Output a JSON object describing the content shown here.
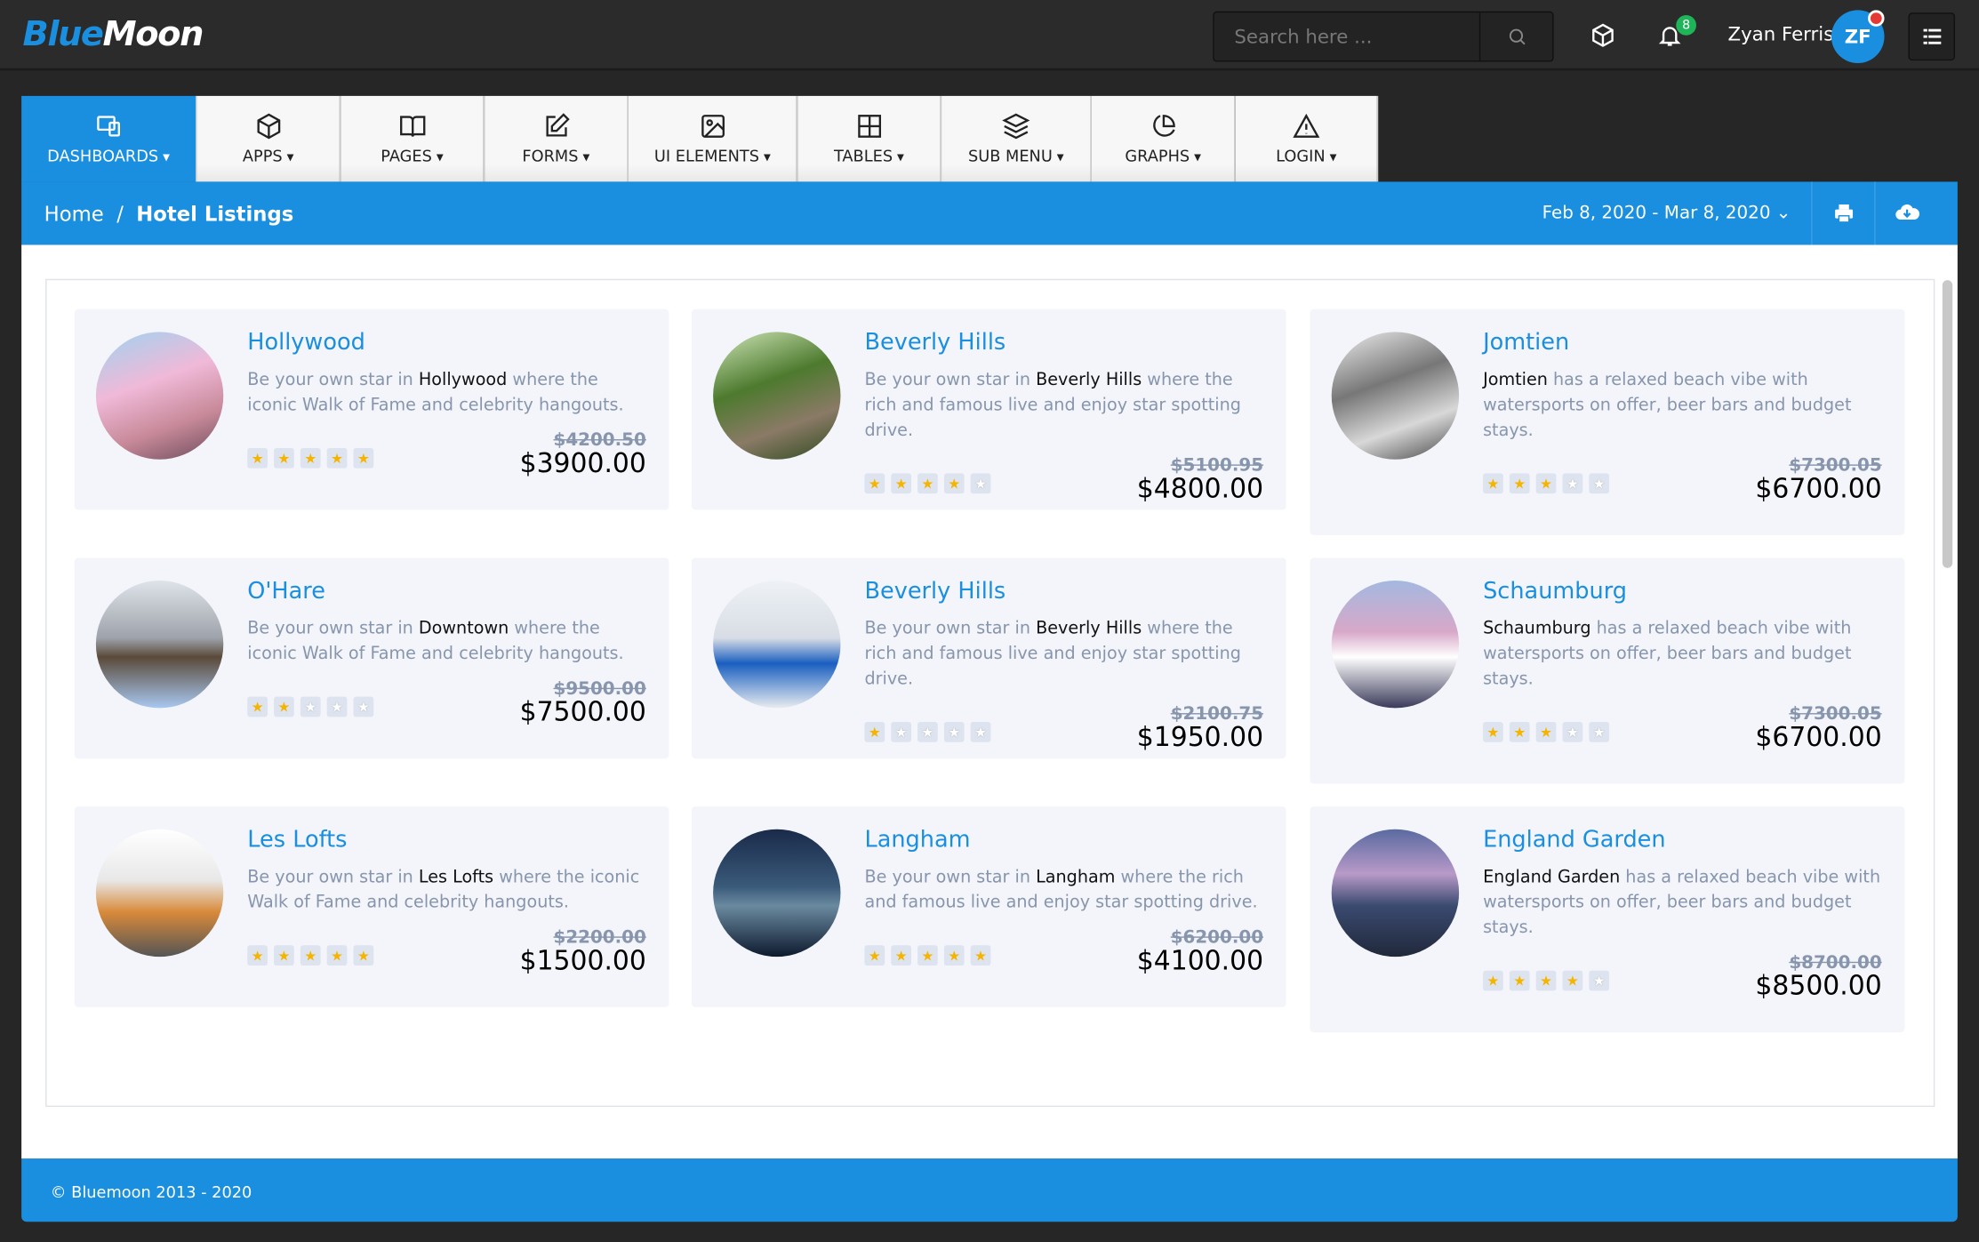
{
  "brand": {
    "part1": "Blue",
    "part2": "Moon"
  },
  "search": {
    "placeholder": "Search here ..."
  },
  "notifications": {
    "count": "8"
  },
  "user": {
    "name": "Zyan Ferris",
    "initials": "ZF"
  },
  "nav": [
    {
      "label": "DASHBOARDS",
      "icon": "dashboard-icon",
      "active": true
    },
    {
      "label": "APPS",
      "icon": "box-icon"
    },
    {
      "label": "PAGES",
      "icon": "book-icon"
    },
    {
      "label": "FORMS",
      "icon": "edit-icon"
    },
    {
      "label": "UI ELEMENTS",
      "icon": "image-icon"
    },
    {
      "label": "TABLES",
      "icon": "grid-icon"
    },
    {
      "label": "SUB MENU",
      "icon": "layers-icon"
    },
    {
      "label": "GRAPHS",
      "icon": "pie-chart-icon"
    },
    {
      "label": "LOGIN",
      "icon": "alert-triangle-icon"
    }
  ],
  "breadcrumb": {
    "home": "Home",
    "sep": "/",
    "current": "Hotel Listings"
  },
  "date_range": "Feb 8, 2020 - Mar 8, 2020",
  "colors": {
    "accent": "#1a8fe0",
    "topbar": "#2b2b2b",
    "card": "#f3f5fa"
  },
  "listings": [
    {
      "name": "Hollywood",
      "pre": "Be your own star in ",
      "hl": "Hollywood",
      "post": " where the iconic Walk of Fame and celebrity hangouts.",
      "rating": 5,
      "old": "$4200.50",
      "price": "$3900.00"
    },
    {
      "name": "Beverly Hills",
      "pre": "Be your own star in ",
      "hl": "Beverly Hills",
      "post": " where the rich and famous live and enjoy star spotting drive.",
      "rating": 4,
      "old": "$5100.95",
      "price": "$4800.00"
    },
    {
      "name": "Jomtien",
      "pre": "",
      "hl": "Jomtien",
      "post": " has a relaxed beach vibe with watersports on offer, beer bars and budget stays.",
      "rating": 3,
      "old": "$7300.05",
      "price": "$6700.00"
    },
    {
      "name": "O'Hare",
      "pre": "Be your own star in ",
      "hl": "Downtown",
      "post": " where the iconic Walk of Fame and celebrity hangouts.",
      "rating": 2,
      "old": "$9500.00",
      "price": "$7500.00"
    },
    {
      "name": "Beverly Hills",
      "pre": "Be your own star in ",
      "hl": "Beverly Hills",
      "post": " where the rich and famous live and enjoy star spotting drive.",
      "rating": 1,
      "old": "$2100.75",
      "price": "$1950.00"
    },
    {
      "name": "Schaumburg",
      "pre": "",
      "hl": "Schaumburg",
      "post": " has a relaxed beach vibe with watersports on offer, beer bars and budget stays.",
      "rating": 3,
      "old": "$7300.05",
      "price": "$6700.00"
    },
    {
      "name": "Les Lofts",
      "pre": "Be your own star in ",
      "hl": "Les Lofts",
      "post": " where the iconic Walk of Fame and celebrity hangouts.",
      "rating": 5,
      "old": "$2200.00",
      "price": "$1500.00"
    },
    {
      "name": "Langham",
      "pre": "Be your own star in ",
      "hl": "Langham",
      "post": " where the rich and famous live and enjoy star spotting drive.",
      "rating": 5,
      "old": "$6200.00",
      "price": "$4100.00"
    },
    {
      "name": "England Garden",
      "pre": "",
      "hl": "England Garden",
      "post": " has a relaxed beach vibe with watersports on offer, beer bars and budget stays.",
      "rating": 4,
      "old": "$8700.00",
      "price": "$8500.00"
    }
  ],
  "footer": "© Bluemoon 2013 - 2020"
}
